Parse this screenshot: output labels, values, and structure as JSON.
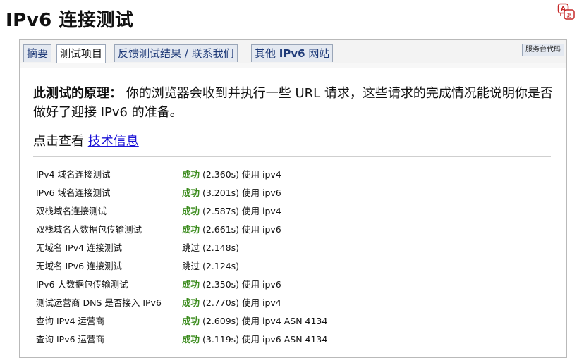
{
  "page": {
    "title": "IPv6 连接测试"
  },
  "tabs": [
    {
      "label": "摘要"
    },
    {
      "label": "测试项目"
    },
    {
      "label": "反馈测试结果 / 联系我们"
    },
    {
      "label_prefix": "其他 ",
      "label_strong": "IPv6",
      "label_suffix": " 网站"
    }
  ],
  "active_tab": "测试项目",
  "helpdesk_label": "服务台代码",
  "intro": {
    "lead": "此测试的原理：",
    "text": " 你的浏览器会收到并执行一些 URL 请求，这些请求的完成情况能说明你是否做好了迎接 IPv6 的准备。"
  },
  "more_info": {
    "prefix": "点击查看 ",
    "link": "技术信息"
  },
  "results": [
    {
      "name": "IPv4 域名连接测试",
      "status": "成功",
      "detail": " (2.360s) 使用 ipv4"
    },
    {
      "name": "IPv6 域名连接测试",
      "status": "成功",
      "detail": " (3.201s) 使用 ipv6"
    },
    {
      "name": "双栈域名连接测试",
      "status": "成功",
      "detail": " (2.587s) 使用 ipv4"
    },
    {
      "name": "双栈域名大数据包传输测试",
      "status": "成功",
      "detail": " (2.661s) 使用 ipv6"
    },
    {
      "name": "无域名 IPv4 连接测试",
      "status": "",
      "detail": "跳过 (2.148s)"
    },
    {
      "name": "无域名 IPv6 连接测试",
      "status": "",
      "detail": "跳过 (2.124s)"
    },
    {
      "name": "IPv6 大数据包传输测试",
      "status": "成功",
      "detail": " (2.350s) 使用 ipv6"
    },
    {
      "name": "测试运营商 DNS 是否接入 IPv6",
      "status": "成功",
      "detail": " (2.770s) 使用 ipv4"
    },
    {
      "name": "查询 IPv4 运营商",
      "status": "成功",
      "detail": " (2.609s) 使用 ipv4 ASN 4134"
    },
    {
      "name": "查询 IPv6 运营商",
      "status": "成功",
      "detail": " (3.119s) 使用 ipv6 ASN 4134"
    }
  ],
  "colors": {
    "success": "#3c8c1e",
    "link": "#1a12d6",
    "tab_bg": "#e4e9f1"
  }
}
